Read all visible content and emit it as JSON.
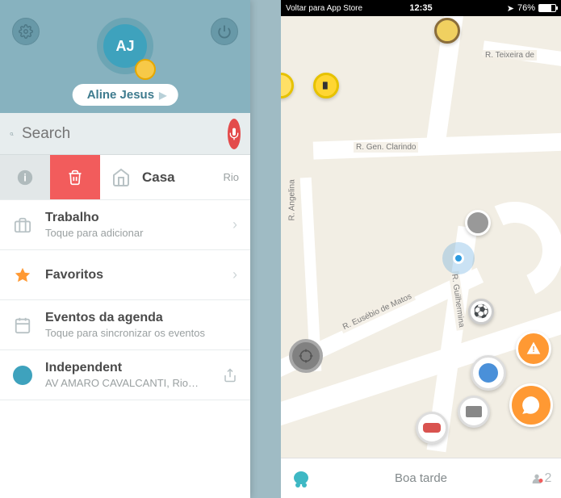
{
  "left": {
    "avatar_initials": "AJ",
    "user_name": "Aline Jesus",
    "search_placeholder": "Search",
    "casa": {
      "title": "Casa",
      "trail": "Rio"
    },
    "trabalho": {
      "title": "Trabalho",
      "sub": "Toque para adicionar"
    },
    "favoritos": {
      "title": "Favoritos"
    },
    "agenda": {
      "title": "Eventos da agenda",
      "sub": "Toque para sincronizar os eventos"
    },
    "independent": {
      "title": "Independent",
      "sub": "AV AMARO CAVALCANTI, Rio…"
    }
  },
  "right": {
    "status": {
      "back": "Voltar para App Store",
      "time": "12:35",
      "battery": "76%"
    },
    "streets": {
      "teixeira": "R. Teixeira de",
      "clarindo": "R. Gen. Clarindo",
      "angelina": "R. Angelina",
      "eusebio": "R. Eusébio de Matos",
      "guilhermina": "R. Guilhermina"
    },
    "greeting": "Boa tarde",
    "friends_count": "2"
  }
}
